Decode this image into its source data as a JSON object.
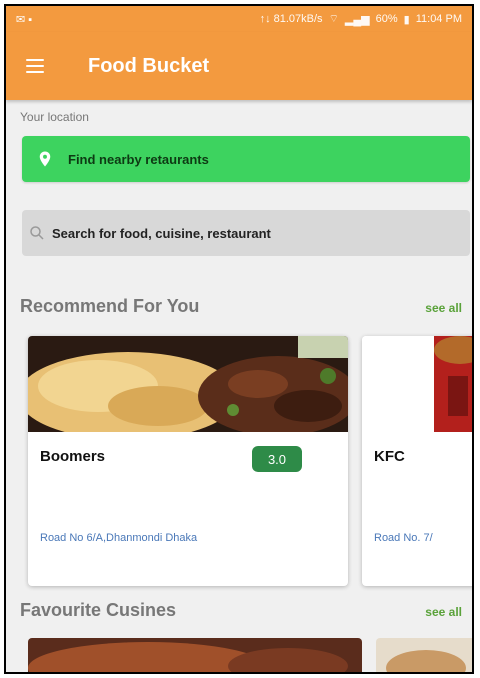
{
  "status_bar": {
    "network_speed": "↑↓ 81.07kB/s",
    "battery": "60%",
    "time": "11:04 PM"
  },
  "app_bar": {
    "title": "Food Bucket",
    "menu_icon": "hamburger-menu-icon"
  },
  "location": {
    "label": "Your location",
    "button_label": "Find nearby retaurants",
    "button_color": "#3dd35f"
  },
  "search": {
    "placeholder": "Search for food, cuisine, restaurant"
  },
  "recommend": {
    "title": "Recommend For You",
    "see_all": "see all",
    "cards": [
      {
        "name": "Boomers",
        "rating": "3.0",
        "address": "Road No 6/A,Dhanmondi Dhaka"
      },
      {
        "name": "KFC",
        "address": "Road No. 7/"
      }
    ]
  },
  "favourite": {
    "title": "Favourite Cusines",
    "see_all": "see all"
  },
  "colors": {
    "primary": "#f39a3f",
    "rating_badge": "#2e8b48",
    "link": "#5aa23a"
  }
}
